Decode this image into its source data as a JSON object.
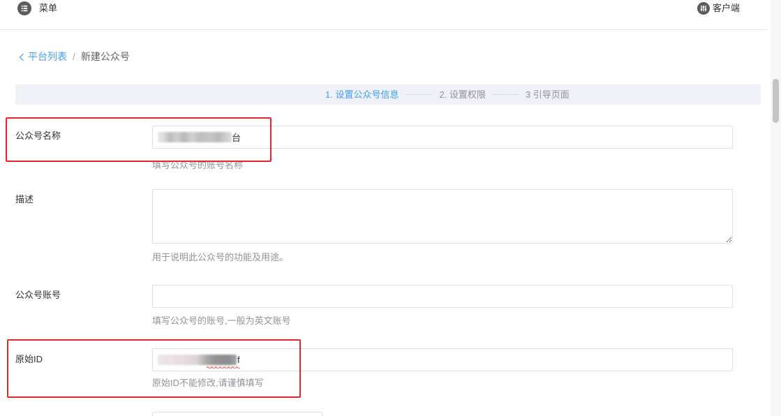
{
  "header": {
    "menu": {
      "label": "菜单",
      "icon": "menu-list-icon"
    },
    "client": {
      "label": "客户端",
      "icon": "sliders-icon"
    }
  },
  "breadcrumb": {
    "back_icon": "chevron-left-icon",
    "parent": "平台列表",
    "separator": "/",
    "current": "新建公众号"
  },
  "steps": {
    "active_index": 0,
    "items": [
      "1. 设置公众号信息",
      "2. 设置权限",
      "3 引导页面"
    ]
  },
  "form": {
    "name": {
      "label": "公众号名称",
      "value": "台",
      "help": "填写公众号的账号名称"
    },
    "description": {
      "label": "描述",
      "help": "用于说明此公众号的功能及用途。"
    },
    "account": {
      "label": "公众号账号",
      "help": "填写公众号的账号,一般为英文账号"
    },
    "original_id": {
      "label": "原始ID",
      "value": "f",
      "help": "原始ID不能修改,请谨慎填写"
    }
  },
  "colors": {
    "accent": "#409eff",
    "annotation": "#e8242b",
    "text": "#303133",
    "muted": "#909399",
    "steps_bg": "#eef1f6",
    "border": "#dcdfe6"
  }
}
